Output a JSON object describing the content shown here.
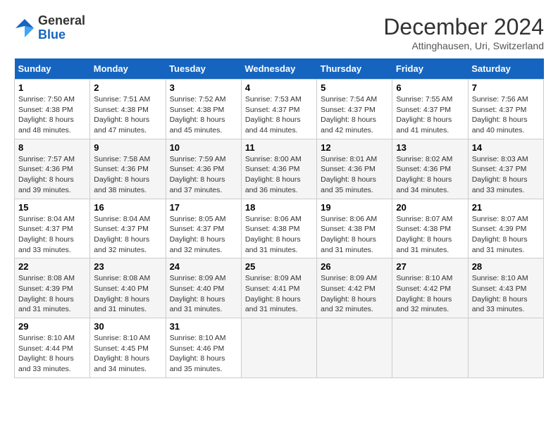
{
  "header": {
    "logo_general": "General",
    "logo_blue": "Blue",
    "month_title": "December 2024",
    "location": "Attinghausen, Uri, Switzerland"
  },
  "weekdays": [
    "Sunday",
    "Monday",
    "Tuesday",
    "Wednesday",
    "Thursday",
    "Friday",
    "Saturday"
  ],
  "weeks": [
    [
      {
        "day": "1",
        "sunrise": "7:50 AM",
        "sunset": "4:38 PM",
        "daylight": "8 hours and 48 minutes."
      },
      {
        "day": "2",
        "sunrise": "7:51 AM",
        "sunset": "4:38 PM",
        "daylight": "8 hours and 47 minutes."
      },
      {
        "day": "3",
        "sunrise": "7:52 AM",
        "sunset": "4:38 PM",
        "daylight": "8 hours and 45 minutes."
      },
      {
        "day": "4",
        "sunrise": "7:53 AM",
        "sunset": "4:37 PM",
        "daylight": "8 hours and 44 minutes."
      },
      {
        "day": "5",
        "sunrise": "7:54 AM",
        "sunset": "4:37 PM",
        "daylight": "8 hours and 42 minutes."
      },
      {
        "day": "6",
        "sunrise": "7:55 AM",
        "sunset": "4:37 PM",
        "daylight": "8 hours and 41 minutes."
      },
      {
        "day": "7",
        "sunrise": "7:56 AM",
        "sunset": "4:37 PM",
        "daylight": "8 hours and 40 minutes."
      }
    ],
    [
      {
        "day": "8",
        "sunrise": "7:57 AM",
        "sunset": "4:36 PM",
        "daylight": "8 hours and 39 minutes."
      },
      {
        "day": "9",
        "sunrise": "7:58 AM",
        "sunset": "4:36 PM",
        "daylight": "8 hours and 38 minutes."
      },
      {
        "day": "10",
        "sunrise": "7:59 AM",
        "sunset": "4:36 PM",
        "daylight": "8 hours and 37 minutes."
      },
      {
        "day": "11",
        "sunrise": "8:00 AM",
        "sunset": "4:36 PM",
        "daylight": "8 hours and 36 minutes."
      },
      {
        "day": "12",
        "sunrise": "8:01 AM",
        "sunset": "4:36 PM",
        "daylight": "8 hours and 35 minutes."
      },
      {
        "day": "13",
        "sunrise": "8:02 AM",
        "sunset": "4:36 PM",
        "daylight": "8 hours and 34 minutes."
      },
      {
        "day": "14",
        "sunrise": "8:03 AM",
        "sunset": "4:37 PM",
        "daylight": "8 hours and 33 minutes."
      }
    ],
    [
      {
        "day": "15",
        "sunrise": "8:04 AM",
        "sunset": "4:37 PM",
        "daylight": "8 hours and 33 minutes."
      },
      {
        "day": "16",
        "sunrise": "8:04 AM",
        "sunset": "4:37 PM",
        "daylight": "8 hours and 32 minutes."
      },
      {
        "day": "17",
        "sunrise": "8:05 AM",
        "sunset": "4:37 PM",
        "daylight": "8 hours and 32 minutes."
      },
      {
        "day": "18",
        "sunrise": "8:06 AM",
        "sunset": "4:38 PM",
        "daylight": "8 hours and 31 minutes."
      },
      {
        "day": "19",
        "sunrise": "8:06 AM",
        "sunset": "4:38 PM",
        "daylight": "8 hours and 31 minutes."
      },
      {
        "day": "20",
        "sunrise": "8:07 AM",
        "sunset": "4:38 PM",
        "daylight": "8 hours and 31 minutes."
      },
      {
        "day": "21",
        "sunrise": "8:07 AM",
        "sunset": "4:39 PM",
        "daylight": "8 hours and 31 minutes."
      }
    ],
    [
      {
        "day": "22",
        "sunrise": "8:08 AM",
        "sunset": "4:39 PM",
        "daylight": "8 hours and 31 minutes."
      },
      {
        "day": "23",
        "sunrise": "8:08 AM",
        "sunset": "4:40 PM",
        "daylight": "8 hours and 31 minutes."
      },
      {
        "day": "24",
        "sunrise": "8:09 AM",
        "sunset": "4:40 PM",
        "daylight": "8 hours and 31 minutes."
      },
      {
        "day": "25",
        "sunrise": "8:09 AM",
        "sunset": "4:41 PM",
        "daylight": "8 hours and 31 minutes."
      },
      {
        "day": "26",
        "sunrise": "8:09 AM",
        "sunset": "4:42 PM",
        "daylight": "8 hours and 32 minutes."
      },
      {
        "day": "27",
        "sunrise": "8:10 AM",
        "sunset": "4:42 PM",
        "daylight": "8 hours and 32 minutes."
      },
      {
        "day": "28",
        "sunrise": "8:10 AM",
        "sunset": "4:43 PM",
        "daylight": "8 hours and 33 minutes."
      }
    ],
    [
      {
        "day": "29",
        "sunrise": "8:10 AM",
        "sunset": "4:44 PM",
        "daylight": "8 hours and 33 minutes."
      },
      {
        "day": "30",
        "sunrise": "8:10 AM",
        "sunset": "4:45 PM",
        "daylight": "8 hours and 34 minutes."
      },
      {
        "day": "31",
        "sunrise": "8:10 AM",
        "sunset": "4:46 PM",
        "daylight": "8 hours and 35 minutes."
      },
      null,
      null,
      null,
      null
    ]
  ],
  "labels": {
    "sunrise": "Sunrise:",
    "sunset": "Sunset:",
    "daylight": "Daylight:"
  }
}
